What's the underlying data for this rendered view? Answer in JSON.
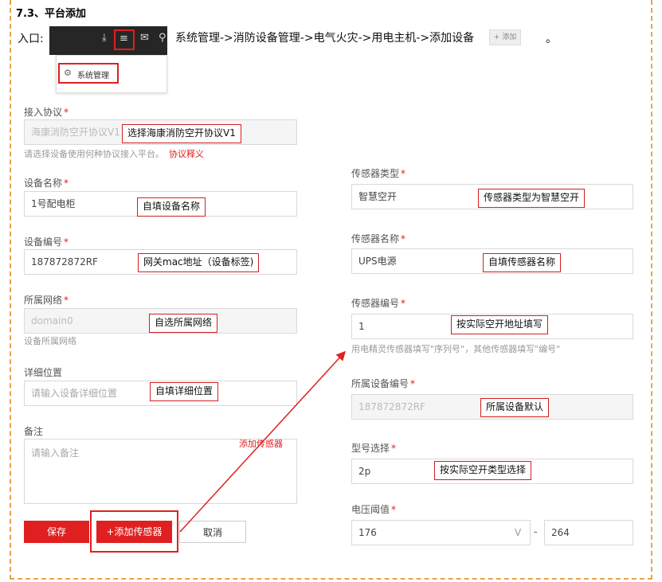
{
  "section_title": "7.3、平台添加",
  "entry": {
    "label": "入口:",
    "path": "系统管理->消防设备管理->电气火灾->用电主机->添加设备",
    "add_chip": "+ 添加",
    "dot": "。",
    "menu_item": "系统管理"
  },
  "left_form": {
    "protocol": {
      "label": "接入协议",
      "value": "海康消防空开协议V1",
      "note": "选择海康消防空开协议V1",
      "hint": "请选择设备使用何种协议接入平台。",
      "hint_link": "协议释义"
    },
    "name": {
      "label": "设备名称",
      "value": "1号配电柜",
      "note": "自填设备名称"
    },
    "code": {
      "label": "设备编号",
      "value": "187872872RF",
      "note": "网关mac地址（设备标签)"
    },
    "network": {
      "label": "所属网络",
      "value": "domain0",
      "note": "自选所属网络",
      "hint": "设备所属网络"
    },
    "location": {
      "label": "详细位置",
      "placeholder": "请输入设备详细位置",
      "note": "自填详细位置"
    },
    "remark": {
      "label": "备注",
      "placeholder": "请输入备注"
    }
  },
  "buttons": {
    "save": "保存",
    "add_sensor": "+添加传感器",
    "cancel": "取消"
  },
  "arrow_label": "添加传感器",
  "right_form": {
    "sensor_type": {
      "label": "传感器类型",
      "value": "智慧空开",
      "note": "传感器类型为智慧空开"
    },
    "sensor_name": {
      "label": "传感器名称",
      "value": "UPS电源",
      "note": "自填传感器名称"
    },
    "sensor_code": {
      "label": "传感器编号",
      "value": "1",
      "note": "按实际空开地址填写",
      "hint": "用电精灵传感器填写\"序列号\"，其他传感器填写\"编号\""
    },
    "device_code": {
      "label": "所属设备编号",
      "value": "187872872RF",
      "note": "所属设备默认"
    },
    "model": {
      "label": "型号选择",
      "value": "2p",
      "note": "按实际空开类型选择"
    },
    "voltage": {
      "label": "电压阈值",
      "min": "176",
      "unit": "V",
      "dash": "-",
      "max": "264"
    }
  },
  "colors": {
    "accent": "#e02020",
    "frame": "#e8a34a"
  }
}
